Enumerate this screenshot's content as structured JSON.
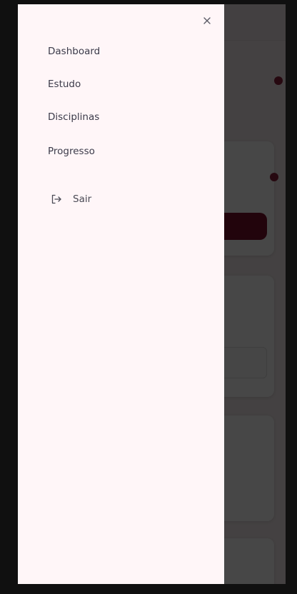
{
  "drawer": {
    "nav_items": [
      {
        "label": "Dashboard"
      },
      {
        "label": "Estudo"
      },
      {
        "label": "Disciplinas"
      },
      {
        "label": "Progresso"
      }
    ],
    "logout_label": "Sair",
    "close_icon": "close-icon",
    "logout_icon": "logout-icon"
  },
  "colors": {
    "drawer_bg": "#fff6f8",
    "accent": "#7a0f2d",
    "text": "#3b3b4a"
  }
}
